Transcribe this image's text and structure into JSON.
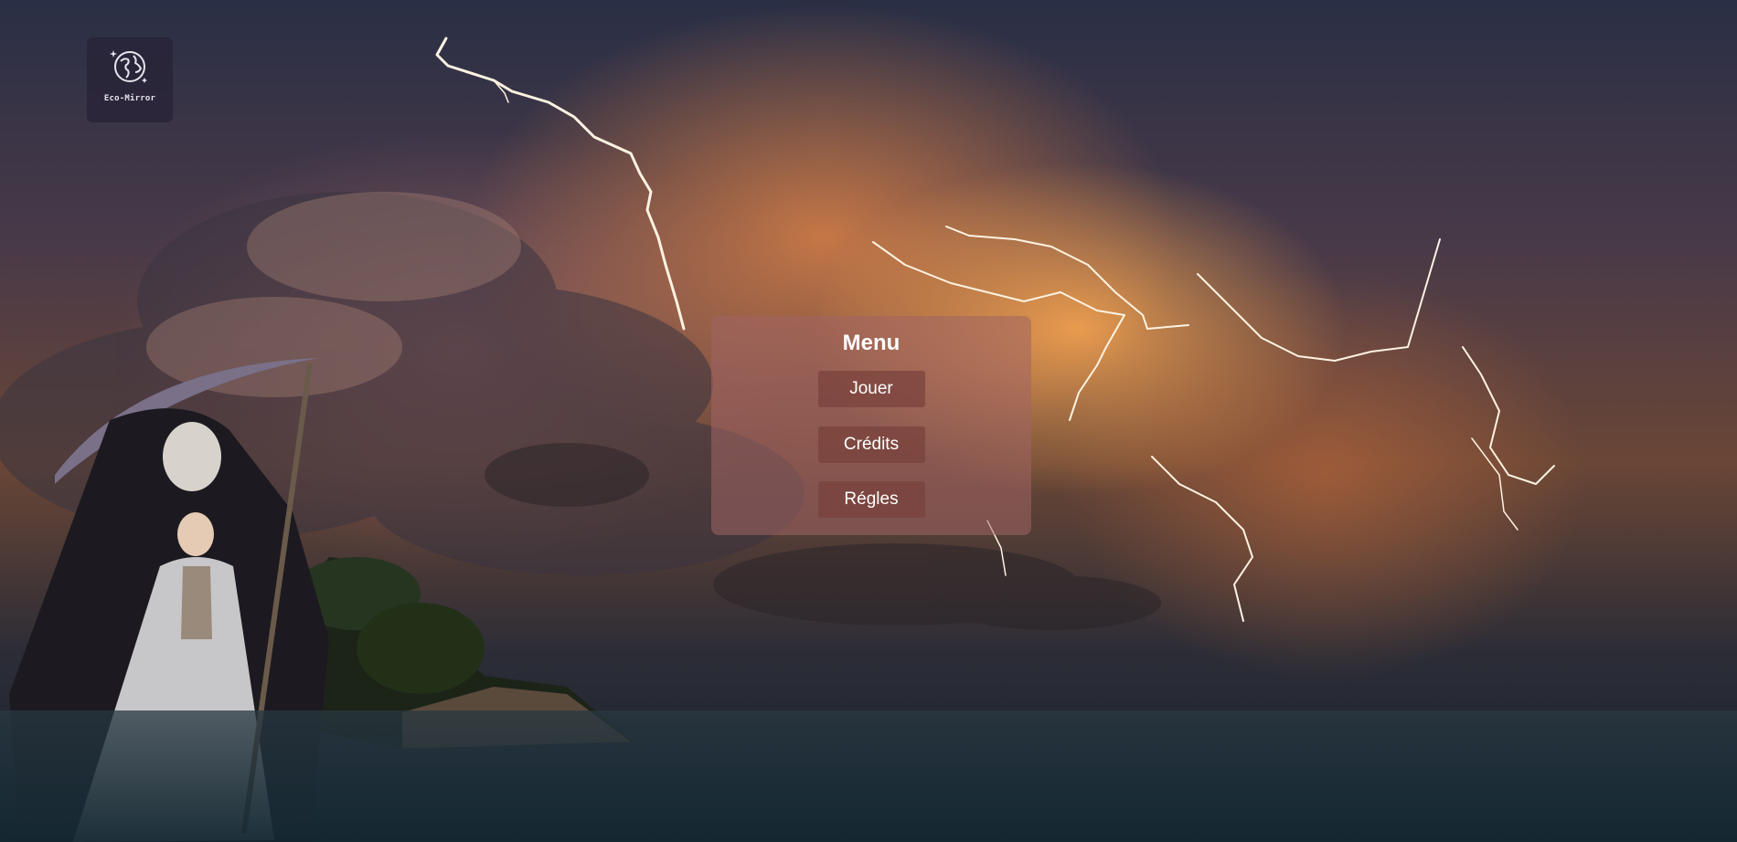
{
  "logo": {
    "name": "Eco-Mirror",
    "icon": "globe-icon"
  },
  "menu": {
    "title": "Menu",
    "buttons": [
      {
        "label": "Jouer"
      },
      {
        "label": "Crédits"
      },
      {
        "label": "Régles"
      }
    ]
  },
  "background": {
    "scene": "stormy sky with lightning over sea, island and reaper figure",
    "accent": "#e8893f",
    "sky_dark": "#2a2f45"
  }
}
